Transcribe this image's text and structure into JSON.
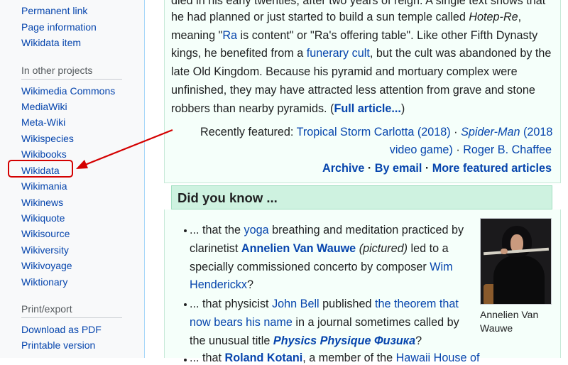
{
  "sidebar": {
    "tools": [
      "Permanent link",
      "Page information",
      "Wikidata item"
    ],
    "other_projects_heading": "In other projects",
    "other_projects": [
      "Wikimedia Commons",
      "MediaWiki",
      "Meta-Wiki",
      "Wikispecies",
      "Wikibooks",
      "Wikidata",
      "Wikimania",
      "Wikinews",
      "Wikiquote",
      "Wikisource",
      "Wikiversity",
      "Wikivoyage",
      "Wiktionary"
    ],
    "print_heading": "Print/export",
    "print_items": [
      "Download as PDF",
      "Printable version"
    ]
  },
  "featured": {
    "line1": "died in his early twenties, after two years of reign. A single text shows that",
    "line2_a": "he had planned or just started to build a sun temple called ",
    "line2_b": "Hotep-Re",
    "line2_c": ",",
    "line3_a": "meaning \"",
    "line3_b": "Ra",
    "line3_c": " is content\" or \"Ra's offering table\". Like other Fifth Dynasty",
    "line4_a": "kings, he benefited from a ",
    "line4_b": "funerary cult",
    "line4_c": ", but the cult was abandoned by the",
    "line5": "late Old Kingdom. Because his pyramid and mortuary complex were",
    "line6": "unfinished, they may have attracted less attention from grave and stone",
    "line7_a": "robbers than nearby pyramids. (",
    "line7_b": "Full article...",
    "line7_c": ")",
    "recent_label": "Recently featured: ",
    "recent_1": "Tropical Storm Carlotta (2018)",
    "recent_dot": " · ",
    "recent_2a": "Spider-Man",
    "recent_2b": " (2018",
    "recent_2c": "video game)",
    "recent_3": "Roger B. Chaffee",
    "archive": "Archive",
    "by_email": "By email",
    "more": "More featured articles"
  },
  "dyk": {
    "header": "Did you know ...",
    "i1_l1_a": "... that the ",
    "i1_l1_b": "yoga",
    "i1_l1_c": " breathing and meditation practiced by",
    "i1_l2_a": "clarinetist ",
    "i1_l2_b": "Annelien Van Wauwe",
    "i1_l2_c": " ",
    "i1_l2_d": "(pictured)",
    "i1_l2_e": " led to a",
    "i1_l3": "specially commissioned concerto by composer ",
    "i1_l3_b": "Wim",
    "i1_l4_a": "Henderickx",
    "i1_l4_b": "?",
    "i2_l1_a": "... that physicist ",
    "i2_l1_b": "John Bell",
    "i2_l1_c": " published ",
    "i2_l1_d": "the theorem that",
    "i2_l2_a": "now bears his name",
    "i2_l2_b": " in a journal sometimes called by",
    "i2_l3_a": "the unusual title ",
    "i2_l3_b": "Physics Physique Физика",
    "i2_l3_c": "?",
    "i3_a": "... that ",
    "i3_b": "Roland Kotani",
    "i3_c": ", a member of the ",
    "i3_d": "Hawaii House of",
    "caption_1": "Annelien Van",
    "caption_2": "Wauwe"
  },
  "colors": {
    "annotation_red": "#d40000",
    "link": "#0645ad"
  }
}
